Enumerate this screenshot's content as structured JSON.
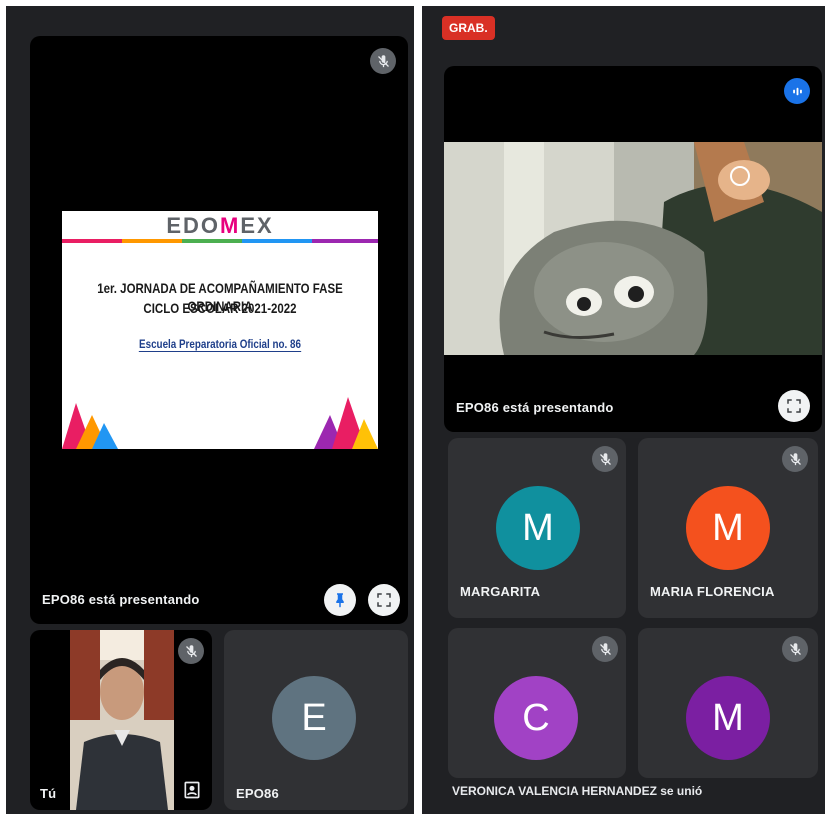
{
  "left": {
    "presenter_label": "EPO86 está presentando",
    "slide": {
      "logo_text_1": "EDO",
      "logo_text_2": "M",
      "logo_text_3": "EX",
      "title_line1": "1er. JORNADA DE ACOMPAÑAMIENTO FASE ORDINARIA",
      "title_line2": "CICLO ESCOLAR 2021-2022",
      "school": "Escuela Preparatoria Oficial no. 86"
    },
    "self_tile_label": "Tú",
    "participant_tile": {
      "label": "EPO86",
      "initial": "E",
      "color": "#5f7380"
    }
  },
  "right": {
    "recording_badge": "GRAB.",
    "presenter_label": "EPO86 está presentando",
    "participants": [
      {
        "name": "MARGARITA",
        "initial": "M",
        "color": "#10909e"
      },
      {
        "name": "MARIA FLORENCIA",
        "initial": "M",
        "color": "#f4511e"
      },
      {
        "name": "",
        "initial": "C",
        "color": "#a142c5"
      },
      {
        "name": "",
        "initial": "M",
        "color": "#7b1fa2"
      }
    ],
    "join_message": "VERONICA VALENCIA HERNANDEZ se unió"
  },
  "icons": {
    "mic_off": "mic-off-icon",
    "fullscreen": "fullscreen-icon",
    "pin": "pin-icon",
    "audio": "audio-activity-icon",
    "layout": "layout-icon"
  }
}
